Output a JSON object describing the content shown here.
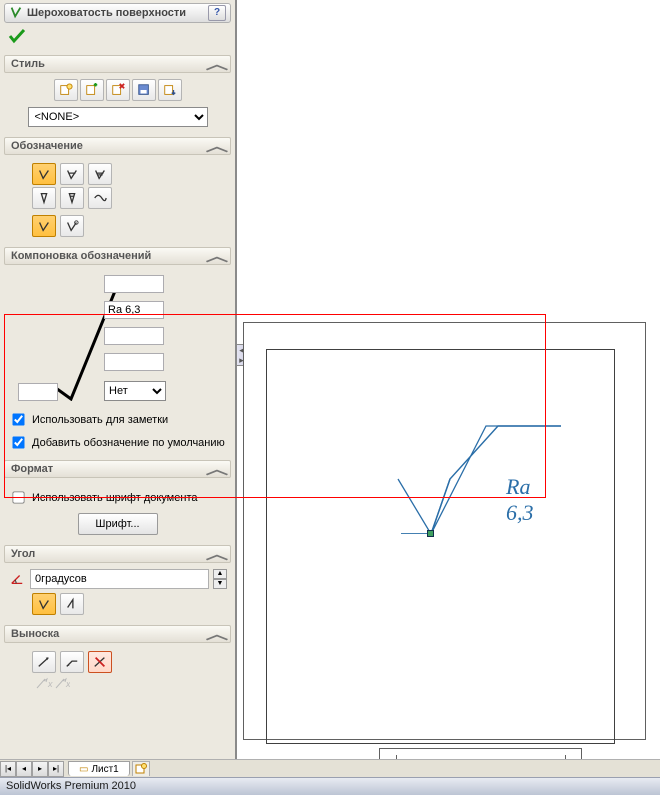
{
  "panel": {
    "title": "Шероховатость поверхности",
    "help": "?"
  },
  "style": {
    "header": "Стиль",
    "select_value": "<NONE>"
  },
  "designation": {
    "header": "Обозначение"
  },
  "layout": {
    "header": "Компоновка обозначений",
    "field2": "Ra 6,3",
    "lay_select": "Нет",
    "chk_note_label": "Использовать для заметки",
    "chk_default_label": "Добавить обозначение по умолчанию"
  },
  "format": {
    "header": "Формат",
    "chk_docfont_label": "Использовать шрифт документа",
    "font_button": "Шрифт..."
  },
  "angle": {
    "header": "Угол",
    "value": "0градусов"
  },
  "leader": {
    "header": "Выноска"
  },
  "canvas": {
    "annotation_text": "Ra 6,3"
  },
  "tabs": {
    "sheet1": "Лист1"
  },
  "status": "SolidWorks Premium 2010"
}
